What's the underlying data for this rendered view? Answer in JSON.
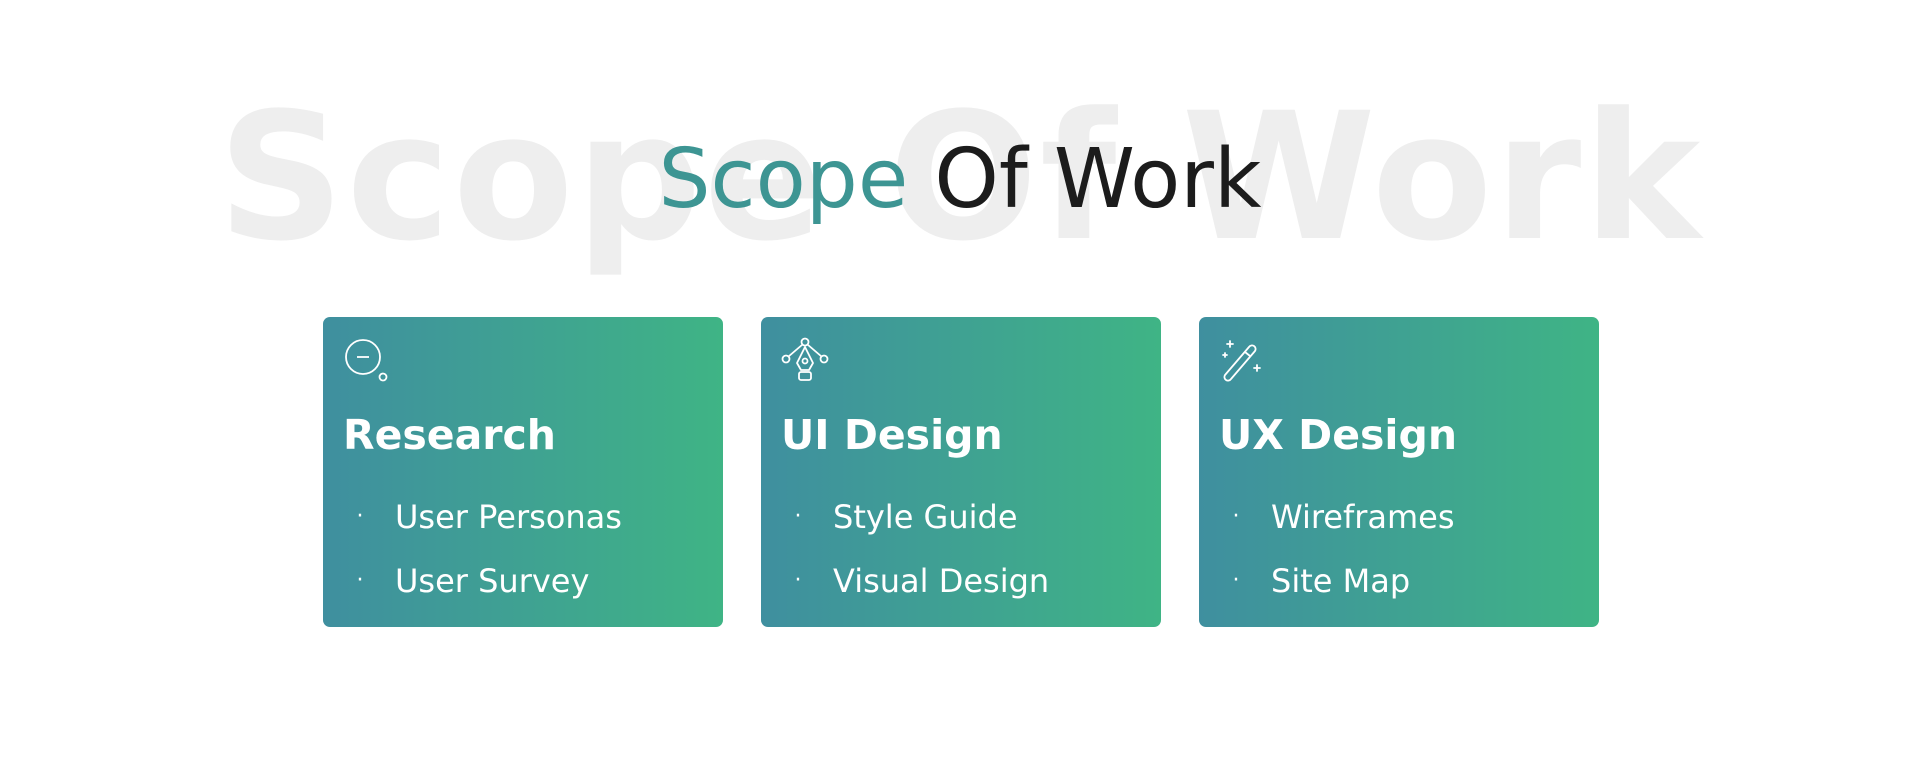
{
  "header": {
    "watermark_text": "Scope Of Work",
    "title_accent": "Scope",
    "title_rest": "Of Work"
  },
  "colors": {
    "accent": "#3d9593",
    "title_dark": "#1c1c1c",
    "watermark": "#eeeeee",
    "card_gradient_start": "#3f8f9f",
    "card_gradient_end": "#3fb485",
    "card_text": "#ffffff"
  },
  "cards": [
    {
      "icon": "magnifier-minus-icon",
      "title": "Research",
      "items": [
        {
          "bullet": "·",
          "label": "User Personas"
        },
        {
          "bullet": "·",
          "label": "User Survey"
        }
      ]
    },
    {
      "icon": "pen-tool-nodes-icon",
      "title": "UI Design",
      "items": [
        {
          "bullet": "·",
          "label": "Style Guide"
        },
        {
          "bullet": "·",
          "label": "Visual Design"
        }
      ]
    },
    {
      "icon": "magic-wand-icon",
      "title": "UX Design",
      "items": [
        {
          "bullet": "·",
          "label": "Wireframes"
        },
        {
          "bullet": "·",
          "label": "Site Map"
        }
      ]
    }
  ]
}
